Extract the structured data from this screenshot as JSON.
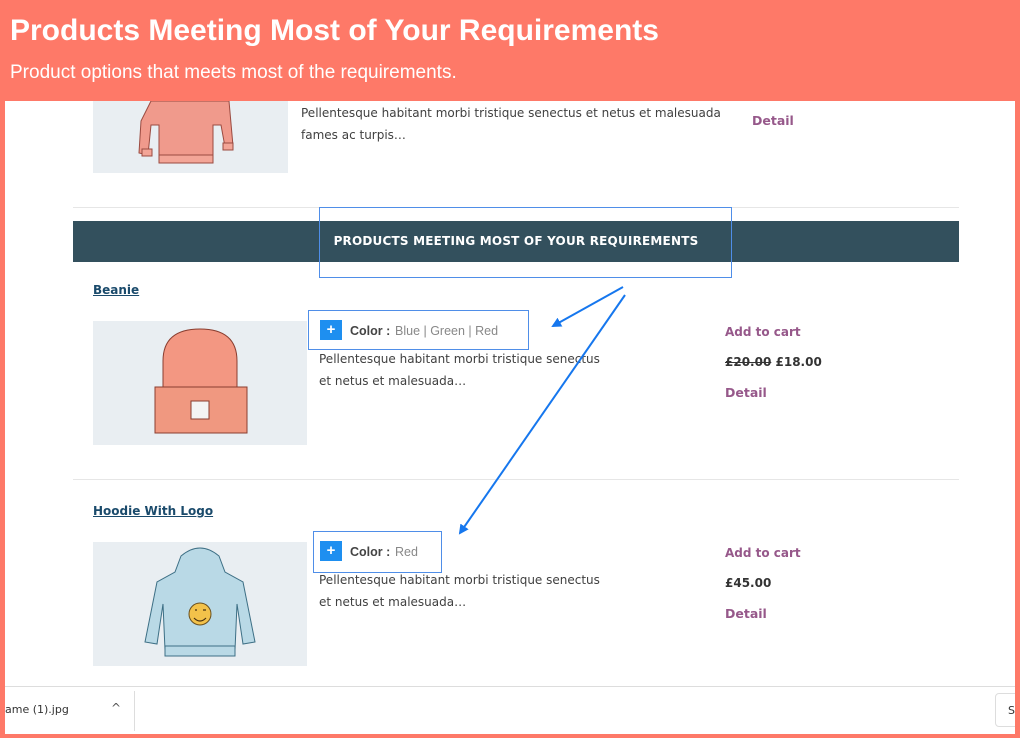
{
  "header": {
    "title": "Products Meeting Most of Your Requirements",
    "subtitle": "Product options that meets most of the requirements."
  },
  "top_product": {
    "description": "Pellentesque habitant morbi tristique senectus et netus et malesuada fames ac turpis…",
    "detail_label": "Detail"
  },
  "section": {
    "title": "PRODUCTS MEETING MOST OF YOUR REQUIREMENTS"
  },
  "products": [
    {
      "name": "Beanie",
      "attr_label": "Color :",
      "attr_value": "Blue | Green | Red",
      "description": "Pellentesque habitant morbi tristique senectus et netus et malesuada…",
      "add_to_cart": "Add to cart",
      "old_price": "£20.00",
      "price": "£18.00",
      "detail_label": "Detail"
    },
    {
      "name": "Hoodie With Logo",
      "attr_label": "Color :",
      "attr_value": "Red",
      "description": "Pellentesque habitant morbi tristique senectus et netus et malesuada…",
      "add_to_cart": "Add to cart",
      "price": "£45.00",
      "detail_label": "Detail"
    }
  ],
  "downloads_bar": {
    "file_name": "ame (1).jpg",
    "caret": "^",
    "show_all": "S"
  },
  "colors": {
    "header_bg": "#fe7968",
    "banner_bg": "#33505d",
    "link_purple": "#96588a",
    "highlight_blue": "#4f8ee8",
    "plus_blue": "#1e8ff0"
  }
}
